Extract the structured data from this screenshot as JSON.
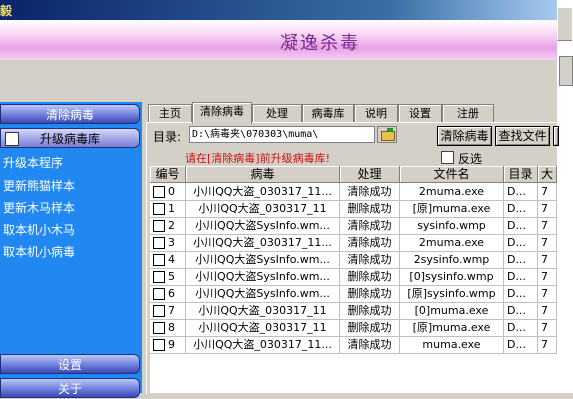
{
  "window": {
    "title_fragment": "毅",
    "banner_title": "凝逸杀毒"
  },
  "sidebar": {
    "buttons": [
      {
        "label": "清除病毒"
      },
      {
        "label": "升级病毒库"
      },
      {
        "label": "设置"
      },
      {
        "label": "关于"
      }
    ],
    "items": [
      {
        "label": "升级本程序"
      },
      {
        "label": "更新熊猫样本"
      },
      {
        "label": "更新木马样本"
      },
      {
        "label": "取本机小木马"
      },
      {
        "label": "取本机小病毒"
      }
    ]
  },
  "tabs": [
    {
      "label": "主页"
    },
    {
      "label": "清除病毒"
    },
    {
      "label": "处理"
    },
    {
      "label": "病毒库"
    },
    {
      "label": "说明"
    },
    {
      "label": "设置"
    },
    {
      "label": "注册"
    }
  ],
  "toolbar": {
    "dir_label": "目录:",
    "dir_value": "D:\\病毒夹\\070303\\muma\\",
    "clear_button": "清除病毒",
    "find_button": "查找文件",
    "warning": "请在[清除病毒]前升级病毒库!",
    "invert_label": "反选"
  },
  "table": {
    "columns": [
      "编号",
      "病毒",
      "处理",
      "文件名",
      "目录",
      "大"
    ],
    "rows": [
      {
        "id": "0",
        "virus": "小川QQ大盗_030317_11...",
        "action": "清除成功",
        "file": "2muma.exe",
        "dir": "D...",
        "size": "7"
      },
      {
        "id": "1",
        "virus": "小川QQ大盗_030317_11",
        "action": "删除成功",
        "file": "[原]muma.exe",
        "dir": "D...",
        "size": "7"
      },
      {
        "id": "2",
        "virus": "小川QQ大盗SysInfo.wm...",
        "action": "清除成功",
        "file": "sysinfo.wmp",
        "dir": "D...",
        "size": "7"
      },
      {
        "id": "3",
        "virus": "小川QQ大盗_030317_11...",
        "action": "清除成功",
        "file": "2muma.exe",
        "dir": "D...",
        "size": "7"
      },
      {
        "id": "4",
        "virus": "小川QQ大盗SysInfo.wm...",
        "action": "清除成功",
        "file": "2sysinfo.wmp",
        "dir": "D...",
        "size": "7"
      },
      {
        "id": "5",
        "virus": "小川QQ大盗SysInfo.wm...",
        "action": "删除成功",
        "file": "[0]sysinfo.wmp",
        "dir": "D...",
        "size": "7"
      },
      {
        "id": "6",
        "virus": "小川QQ大盗SysInfo.wm...",
        "action": "删除成功",
        "file": "[原]sysinfo.wmp",
        "dir": "D...",
        "size": "7"
      },
      {
        "id": "7",
        "virus": "小川QQ大盗_030317_11",
        "action": "删除成功",
        "file": "[0]muma.exe",
        "dir": "D...",
        "size": "7"
      },
      {
        "id": "8",
        "virus": "小川QQ大盗_030317_11",
        "action": "删除成功",
        "file": "[原]muma.exe",
        "dir": "D...",
        "size": "7"
      },
      {
        "id": "9",
        "virus": "小川QQ大盗_030317_11...",
        "action": "清除成功",
        "file": "muma.exe",
        "dir": "D...",
        "size": "7"
      }
    ]
  }
}
